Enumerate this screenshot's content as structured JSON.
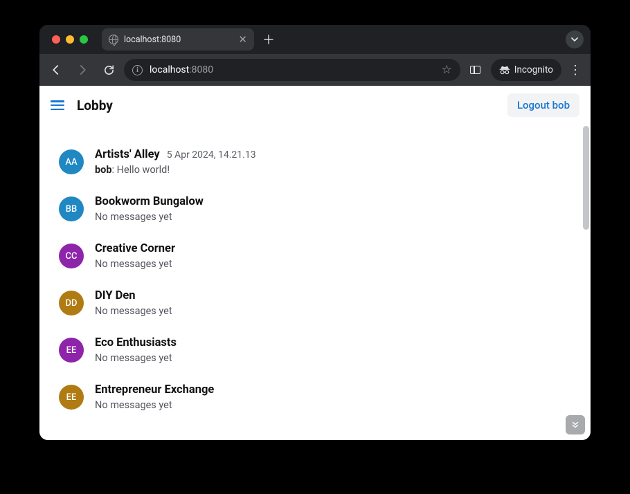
{
  "browser": {
    "tab_title": "localhost:8080",
    "url_host": "localhost",
    "url_path": ":8080",
    "incognito_label": "Incognito"
  },
  "header": {
    "title": "Lobby",
    "logout_label": "Logout bob"
  },
  "rooms": [
    {
      "initials": "AA",
      "color": "#1f88c2",
      "name": "Artists' Alley",
      "timestamp": "5 Apr 2024, 14.21.13",
      "preview_author": "bob",
      "preview_text": ": Hello world!"
    },
    {
      "initials": "BB",
      "color": "#1f88c2",
      "name": "Bookworm Bungalow",
      "timestamp": "",
      "preview_author": "",
      "preview_text": "No messages yet"
    },
    {
      "initials": "CC",
      "color": "#8e24aa",
      "name": "Creative Corner",
      "timestamp": "",
      "preview_author": "",
      "preview_text": "No messages yet"
    },
    {
      "initials": "DD",
      "color": "#b07b13",
      "name": "DIY Den",
      "timestamp": "",
      "preview_author": "",
      "preview_text": "No messages yet"
    },
    {
      "initials": "EE",
      "color": "#8e24aa",
      "name": "Eco Enthusiasts",
      "timestamp": "",
      "preview_author": "",
      "preview_text": "No messages yet"
    },
    {
      "initials": "EE",
      "color": "#b07b13",
      "name": "Entrepreneur Exchange",
      "timestamp": "",
      "preview_author": "",
      "preview_text": "No messages yet"
    }
  ]
}
